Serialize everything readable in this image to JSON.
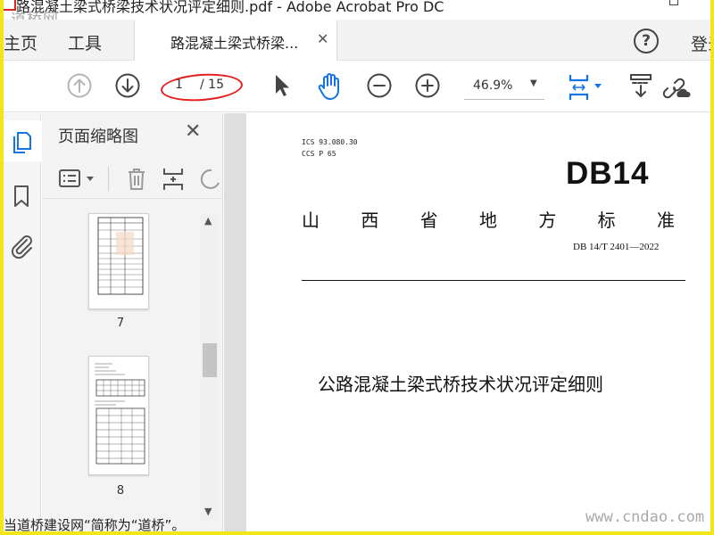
{
  "window": {
    "title": "路混凝土梁式桥梁技术状况评定细则.pdf - Adobe Acrobat Pro DC"
  },
  "nav": {
    "home_label": "主页",
    "tools_label": "工具",
    "doc_tab_label": "路混凝土梁式桥梁...",
    "close_glyph": "✕",
    "help_glyph": "?",
    "signin_label": "登录"
  },
  "toolbar": {
    "page_current": "1",
    "page_total": "/ 15",
    "zoom": "46.9%",
    "zoom_caret": "▼"
  },
  "panel": {
    "title": "页面缩略图",
    "close_glyph": "✕",
    "scroll_up": "▲",
    "scroll_down": "▼",
    "collapse": "◀",
    "thumbnails": [
      {
        "label": "7"
      },
      {
        "label": "8"
      }
    ]
  },
  "document": {
    "ics": "ICS 93.080.30",
    "ccs": "CCS P 65",
    "code": "DB14",
    "province_title": [
      "山",
      "西",
      "省",
      "地",
      "方",
      "标",
      "准"
    ],
    "standard_number": "DB 14/T 2401—2022",
    "title": "公路混凝土梁式桥技术状况评定细则"
  },
  "overlays": {
    "watermark_top": "道桥网",
    "watermark_bottom": "www.cndao.com",
    "caption_bottom": "当道桥建设网“简称为“道桥”。"
  },
  "colors": {
    "accent": "#1473e6",
    "annotation": "#e41d1d",
    "border": "#f0e61a"
  },
  "icons": [
    "prev-page-icon",
    "next-page-icon",
    "select-tool-icon",
    "hand-tool-icon",
    "zoom-out-icon",
    "zoom-in-icon",
    "fit-page-icon",
    "scroll-mode-icon",
    "link-cloud-icon",
    "pages-icon",
    "bookmark-icon",
    "attachment-icon",
    "options-icon",
    "delete-icon",
    "insert-page-icon",
    "rotate-icon"
  ]
}
